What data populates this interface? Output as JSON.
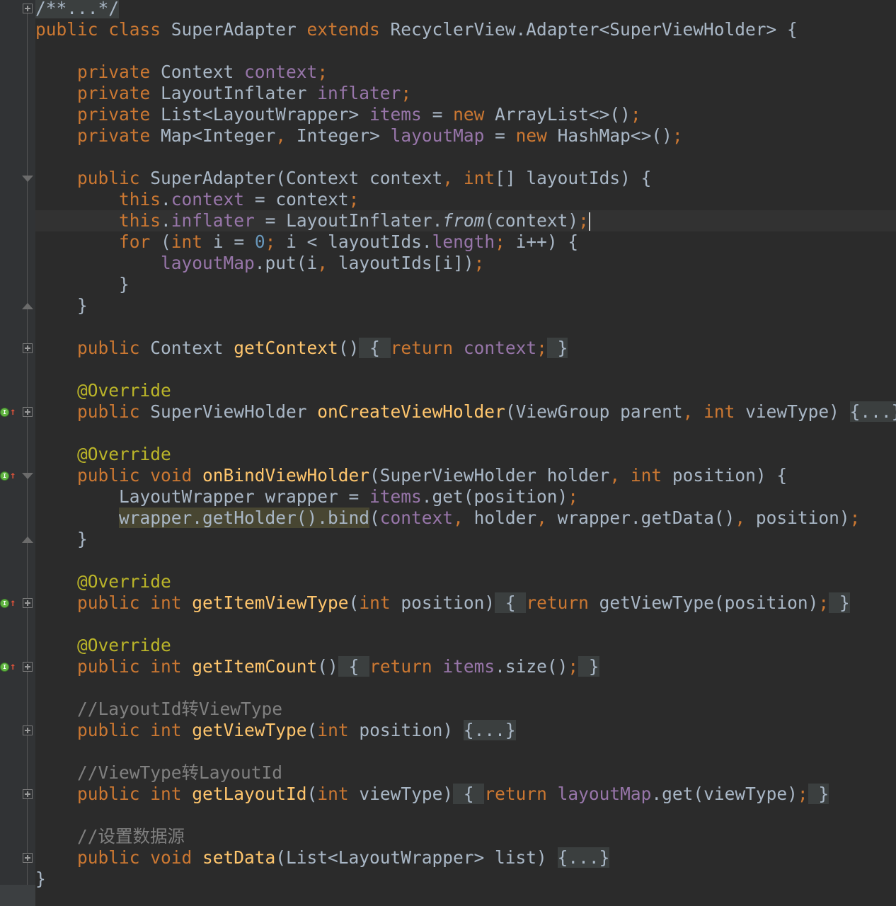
{
  "editor": {
    "language": "java",
    "colors": {
      "background": "#2b2b2b",
      "keyword": "#cc7832",
      "field": "#9876aa",
      "method": "#ffc66d",
      "number": "#6897bb",
      "annotation": "#bbb529",
      "comment": "#808080",
      "text": "#a9b7c6"
    },
    "lines": [
      {
        "text": "/**...*/",
        "gutter": "plus",
        "tokens": [
          {
            "t": "/**...*/",
            "c": "cm fold"
          }
        ]
      },
      {
        "text": "public class SuperAdapter extends RecyclerView.Adapter<SuperViewHolder> {",
        "tokens": [
          {
            "t": "public class ",
            "c": "kw"
          },
          {
            "t": "SuperAdapter "
          },
          {
            "t": "extends ",
            "c": "kw"
          },
          {
            "t": "RecyclerView.Adapter<SuperViewHolder> {"
          }
        ]
      },
      {
        "text": "",
        "tokens": []
      },
      {
        "text": "    private Context context;",
        "tokens": [
          {
            "t": "    "
          },
          {
            "t": "private ",
            "c": "kw"
          },
          {
            "t": "Context "
          },
          {
            "t": "context",
            "c": "fld"
          },
          {
            "t": ";",
            "c": "kw"
          }
        ]
      },
      {
        "text": "    private LayoutInflater inflater;",
        "tokens": [
          {
            "t": "    "
          },
          {
            "t": "private ",
            "c": "kw"
          },
          {
            "t": "LayoutInflater "
          },
          {
            "t": "inflater",
            "c": "fld"
          },
          {
            "t": ";",
            "c": "kw"
          }
        ]
      },
      {
        "text": "    private List<LayoutWrapper> items = new ArrayList<>();",
        "tokens": [
          {
            "t": "    "
          },
          {
            "t": "private ",
            "c": "kw"
          },
          {
            "t": "List<LayoutWrapper> "
          },
          {
            "t": "items",
            "c": "fld"
          },
          {
            "t": " = "
          },
          {
            "t": "new ",
            "c": "kw"
          },
          {
            "t": "ArrayList<>()"
          },
          {
            "t": ";",
            "c": "kw"
          }
        ]
      },
      {
        "text": "    private Map<Integer, Integer> layoutMap = new HashMap<>();",
        "tokens": [
          {
            "t": "    "
          },
          {
            "t": "private ",
            "c": "kw"
          },
          {
            "t": "Map<Integer"
          },
          {
            "t": ", ",
            "c": "kw"
          },
          {
            "t": "Integer> "
          },
          {
            "t": "layoutMap",
            "c": "fld"
          },
          {
            "t": " = "
          },
          {
            "t": "new ",
            "c": "kw"
          },
          {
            "t": "HashMap<>()"
          },
          {
            "t": ";",
            "c": "kw"
          }
        ]
      },
      {
        "text": "",
        "tokens": []
      },
      {
        "text": "    public SuperAdapter(Context context, int[] layoutIds) {",
        "gutter": "fold-start",
        "tokens": [
          {
            "t": "    "
          },
          {
            "t": "public ",
            "c": "kw"
          },
          {
            "t": "SuperAdapter(Context context"
          },
          {
            "t": ", ",
            "c": "kw"
          },
          {
            "t": "int",
            "c": "kw"
          },
          {
            "t": "[] layoutIds) {"
          }
        ]
      },
      {
        "text": "        this.context = context;",
        "tokens": [
          {
            "t": "        "
          },
          {
            "t": "this",
            "c": "kw"
          },
          {
            "t": "."
          },
          {
            "t": "context",
            "c": "fld"
          },
          {
            "t": " = context"
          },
          {
            "t": ";",
            "c": "kw"
          }
        ]
      },
      {
        "text": "        this.inflater = LayoutInflater.from(context);",
        "caret": true,
        "tokens": [
          {
            "t": "        "
          },
          {
            "t": "this",
            "c": "kw"
          },
          {
            "t": "."
          },
          {
            "t": "inflater",
            "c": "fld"
          },
          {
            "t": " = LayoutInflater."
          },
          {
            "t": "from",
            "c": "it"
          },
          {
            "t": "(context)"
          },
          {
            "t": ";",
            "c": "kw"
          }
        ]
      },
      {
        "text": "        for (int i = 0; i < layoutIds.length; i++) {",
        "tokens": [
          {
            "t": "        "
          },
          {
            "t": "for ",
            "c": "kw"
          },
          {
            "t": "("
          },
          {
            "t": "int ",
            "c": "kw"
          },
          {
            "t": "i = "
          },
          {
            "t": "0",
            "c": "num"
          },
          {
            "t": "; ",
            "c": "kw"
          },
          {
            "t": "i < layoutIds."
          },
          {
            "t": "length",
            "c": "fld"
          },
          {
            "t": "; ",
            "c": "kw"
          },
          {
            "t": "i++) {"
          }
        ]
      },
      {
        "text": "            layoutMap.put(i, layoutIds[i]);",
        "tokens": [
          {
            "t": "            "
          },
          {
            "t": "layoutMap",
            "c": "fld"
          },
          {
            "t": ".put(i"
          },
          {
            "t": ", ",
            "c": "kw"
          },
          {
            "t": "layoutIds[i])"
          },
          {
            "t": ";",
            "c": "kw"
          }
        ]
      },
      {
        "text": "        }",
        "tokens": [
          {
            "t": "        }"
          }
        ]
      },
      {
        "text": "    }",
        "gutter": "fold-end",
        "tokens": [
          {
            "t": "    }"
          }
        ]
      },
      {
        "text": "",
        "tokens": []
      },
      {
        "text": "    public Context getContext() { return context; }",
        "gutter": "plus",
        "tokens": [
          {
            "t": "    "
          },
          {
            "t": "public ",
            "c": "kw"
          },
          {
            "t": "Context "
          },
          {
            "t": "getContext",
            "c": "mth"
          },
          {
            "t": "()"
          },
          {
            "t": " { ",
            "c": "fold"
          },
          {
            "t": "return ",
            "c": "kw"
          },
          {
            "t": "context",
            "c": "fld"
          },
          {
            "t": ";",
            "c": "kw"
          },
          {
            "t": " }",
            "c": "fold"
          }
        ]
      },
      {
        "text": "",
        "tokens": []
      },
      {
        "text": "    @Override",
        "tokens": [
          {
            "t": "    "
          },
          {
            "t": "@Override",
            "c": "ann"
          }
        ]
      },
      {
        "text": "    public SuperViewHolder onCreateViewHolder(ViewGroup parent, int viewType) {...}",
        "gutter": "plus",
        "override": true,
        "tokens": [
          {
            "t": "    "
          },
          {
            "t": "public ",
            "c": "kw"
          },
          {
            "t": "SuperViewHolder "
          },
          {
            "t": "onCreateViewHolder",
            "c": "mth"
          },
          {
            "t": "(ViewGroup parent"
          },
          {
            "t": ", ",
            "c": "kw"
          },
          {
            "t": "int ",
            "c": "kw"
          },
          {
            "t": "viewType) "
          },
          {
            "t": "{...}",
            "c": "fold"
          }
        ]
      },
      {
        "text": "",
        "tokens": []
      },
      {
        "text": "    @Override",
        "tokens": [
          {
            "t": "    "
          },
          {
            "t": "@Override",
            "c": "ann"
          }
        ]
      },
      {
        "text": "    public void onBindViewHolder(SuperViewHolder holder, int position) {",
        "gutter": "fold-start",
        "override": true,
        "tokens": [
          {
            "t": "    "
          },
          {
            "t": "public void ",
            "c": "kw"
          },
          {
            "t": "onBindViewHolder",
            "c": "mth"
          },
          {
            "t": "(SuperViewHolder holder"
          },
          {
            "t": ", ",
            "c": "kw"
          },
          {
            "t": "int ",
            "c": "kw"
          },
          {
            "t": "position) {"
          }
        ]
      },
      {
        "text": "        LayoutWrapper wrapper = items.get(position);",
        "tokens": [
          {
            "t": "        LayoutWrapper wrapper = "
          },
          {
            "t": "items",
            "c": "fld"
          },
          {
            "t": ".get(position)"
          },
          {
            "t": ";",
            "c": "kw"
          }
        ]
      },
      {
        "text": "        wrapper.getHolder().bind(context, holder, wrapper.getData(), position);",
        "tokens": [
          {
            "t": "        "
          },
          {
            "t": "wrapper.getHolder().bind",
            "c": "hl"
          },
          {
            "t": "("
          },
          {
            "t": "context",
            "c": "fld"
          },
          {
            "t": ", ",
            "c": "kw"
          },
          {
            "t": "holder"
          },
          {
            "t": ", ",
            "c": "kw"
          },
          {
            "t": "wrapper.getData()"
          },
          {
            "t": ", ",
            "c": "kw"
          },
          {
            "t": "position)"
          },
          {
            "t": ";",
            "c": "kw"
          }
        ]
      },
      {
        "text": "    }",
        "gutter": "fold-end",
        "tokens": [
          {
            "t": "    }"
          }
        ]
      },
      {
        "text": "",
        "tokens": []
      },
      {
        "text": "    @Override",
        "tokens": [
          {
            "t": "    "
          },
          {
            "t": "@Override",
            "c": "ann"
          }
        ]
      },
      {
        "text": "    public int getItemViewType(int position) { return getViewType(position); }",
        "gutter": "plus",
        "override": true,
        "tokens": [
          {
            "t": "    "
          },
          {
            "t": "public int ",
            "c": "kw"
          },
          {
            "t": "getItemViewType",
            "c": "mth"
          },
          {
            "t": "("
          },
          {
            "t": "int ",
            "c": "kw"
          },
          {
            "t": "position)"
          },
          {
            "t": " { ",
            "c": "fold"
          },
          {
            "t": "return ",
            "c": "kw"
          },
          {
            "t": "getViewType(position)"
          },
          {
            "t": ";",
            "c": "kw"
          },
          {
            "t": " }",
            "c": "fold"
          }
        ]
      },
      {
        "text": "",
        "tokens": []
      },
      {
        "text": "    @Override",
        "tokens": [
          {
            "t": "    "
          },
          {
            "t": "@Override",
            "c": "ann"
          }
        ]
      },
      {
        "text": "    public int getItemCount() { return items.size(); }",
        "gutter": "plus",
        "override": true,
        "tokens": [
          {
            "t": "    "
          },
          {
            "t": "public int ",
            "c": "kw"
          },
          {
            "t": "getItemCount",
            "c": "mth"
          },
          {
            "t": "()"
          },
          {
            "t": " { ",
            "c": "fold"
          },
          {
            "t": "return ",
            "c": "kw"
          },
          {
            "t": "items",
            "c": "fld"
          },
          {
            "t": ".size()"
          },
          {
            "t": ";",
            "c": "kw"
          },
          {
            "t": " }",
            "c": "fold"
          }
        ]
      },
      {
        "text": "",
        "tokens": []
      },
      {
        "text": "    //LayoutId转ViewType",
        "tokens": [
          {
            "t": "    "
          },
          {
            "t": "//LayoutId转ViewType",
            "c": "cm"
          }
        ]
      },
      {
        "text": "    public int getViewType(int position) {...}",
        "gutter": "plus",
        "tokens": [
          {
            "t": "    "
          },
          {
            "t": "public int ",
            "c": "kw"
          },
          {
            "t": "getViewType",
            "c": "mth"
          },
          {
            "t": "("
          },
          {
            "t": "int ",
            "c": "kw"
          },
          {
            "t": "position) "
          },
          {
            "t": "{...}",
            "c": "fold"
          }
        ]
      },
      {
        "text": "",
        "tokens": []
      },
      {
        "text": "    //ViewType转LayoutId",
        "tokens": [
          {
            "t": "    "
          },
          {
            "t": "//ViewType转LayoutId",
            "c": "cm"
          }
        ]
      },
      {
        "text": "    public int getLayoutId(int viewType) { return layoutMap.get(viewType); }",
        "gutter": "plus",
        "tokens": [
          {
            "t": "    "
          },
          {
            "t": "public int ",
            "c": "kw"
          },
          {
            "t": "getLayoutId",
            "c": "mth"
          },
          {
            "t": "("
          },
          {
            "t": "int ",
            "c": "kw"
          },
          {
            "t": "viewType)"
          },
          {
            "t": " { ",
            "c": "fold"
          },
          {
            "t": "return ",
            "c": "kw"
          },
          {
            "t": "layoutMap",
            "c": "fld"
          },
          {
            "t": ".get(viewType)"
          },
          {
            "t": ";",
            "c": "kw"
          },
          {
            "t": " }",
            "c": "fold"
          }
        ]
      },
      {
        "text": "",
        "tokens": []
      },
      {
        "text": "    //设置数据源",
        "tokens": [
          {
            "t": "    "
          },
          {
            "t": "//设置数据源",
            "c": "cm"
          }
        ]
      },
      {
        "text": "    public void setData(List<LayoutWrapper> list) {...}",
        "gutter": "plus",
        "tokens": [
          {
            "t": "    "
          },
          {
            "t": "public void ",
            "c": "kw"
          },
          {
            "t": "setData",
            "c": "mth"
          },
          {
            "t": "(List<LayoutWrapper> list) "
          },
          {
            "t": "{...}",
            "c": "fold"
          }
        ]
      },
      {
        "text": "}",
        "tokens": [
          {
            "t": "}"
          }
        ]
      }
    ],
    "override_badge": "I"
  }
}
